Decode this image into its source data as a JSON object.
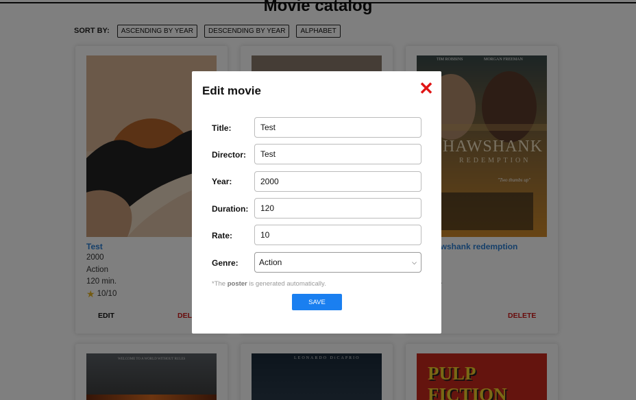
{
  "page": {
    "title": "Movie catalog"
  },
  "sort": {
    "label": "SORT BY:",
    "options": [
      "ASCENDING BY YEAR",
      "DESCENDING BY YEAR",
      "ALPHABET"
    ]
  },
  "movies": [
    {
      "title": "Test",
      "year": "2000",
      "genre": "Action",
      "duration": "120 min.",
      "rate": "10/10",
      "edit": "EDIT",
      "delete": "DELE"
    },
    {
      "title": "awshank redemption",
      "duration_partial": "n.",
      "rate_partial": "0",
      "edit": "T",
      "delete": "DELETE"
    }
  ],
  "bottom_posters": [
    {
      "caption": "WELCOME TO A WORLD WITHOUT RULES"
    },
    {
      "caption": "LEONARDO DiCAPRIO"
    },
    {
      "caption": "PULP FICTION"
    }
  ],
  "modal": {
    "title": "Edit movie",
    "fields": [
      {
        "label": "Title:",
        "value": "Test"
      },
      {
        "label": "Director:",
        "value": "Test"
      },
      {
        "label": "Year:",
        "value": "2000"
      },
      {
        "label": "Duration:",
        "value": "120"
      },
      {
        "label": "Rate:",
        "value": "10"
      }
    ],
    "genre": {
      "label": "Genre:",
      "value": "Action"
    },
    "note_prefix": "*The ",
    "note_bold": "poster",
    "note_suffix": " is generated automatically.",
    "save_label": "SAVE"
  },
  "poster_texts": {
    "shawshank_actors_left": "TIM ROBBINS",
    "shawshank_actors_right": "MORGAN FREEMAN",
    "shawshank_title": "HAWSHANK",
    "shawshank_sub": "REDEMPTION",
    "shawshank_quote": "\"Two thumbs up\""
  },
  "colors": {
    "accent": "#1a7ff0",
    "link": "#2a7fd4",
    "danger": "#d01818"
  }
}
